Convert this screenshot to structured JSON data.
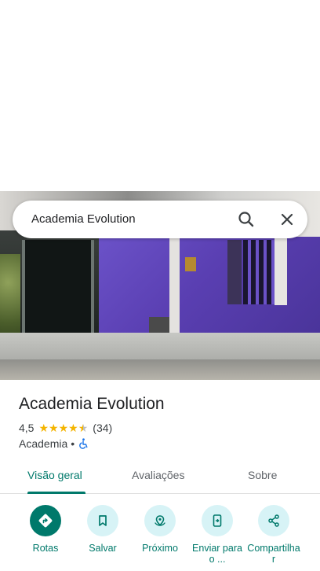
{
  "search": {
    "query": "Academia Evolution"
  },
  "place": {
    "name": "Academia Evolution",
    "rating": "4,5",
    "rating_value": 4.5,
    "review_count": "(34)",
    "category": "Academia",
    "separator": "•"
  },
  "icons": {
    "search": "search-icon",
    "close": "close-icon",
    "accessibility": "wheelchair-icon",
    "directions": "directions-icon",
    "save": "bookmark-icon",
    "nearby": "nearby-icon",
    "send": "send-to-phone-icon",
    "share": "share-icon"
  },
  "tabs": [
    {
      "label": "Visão geral",
      "active": true
    },
    {
      "label": "Avaliações",
      "active": false
    },
    {
      "label": "Sobre",
      "active": false
    }
  ],
  "actions": [
    {
      "label": "Rotas"
    },
    {
      "label": "Salvar"
    },
    {
      "label": "Próximo"
    },
    {
      "label": "Enviar para o ..."
    },
    {
      "label": "Compartilhar"
    }
  ],
  "colors": {
    "accent": "#00796b",
    "action_bg": "#d7f3f6",
    "star": "#f4b400",
    "accessibility": "#1a73e8"
  }
}
